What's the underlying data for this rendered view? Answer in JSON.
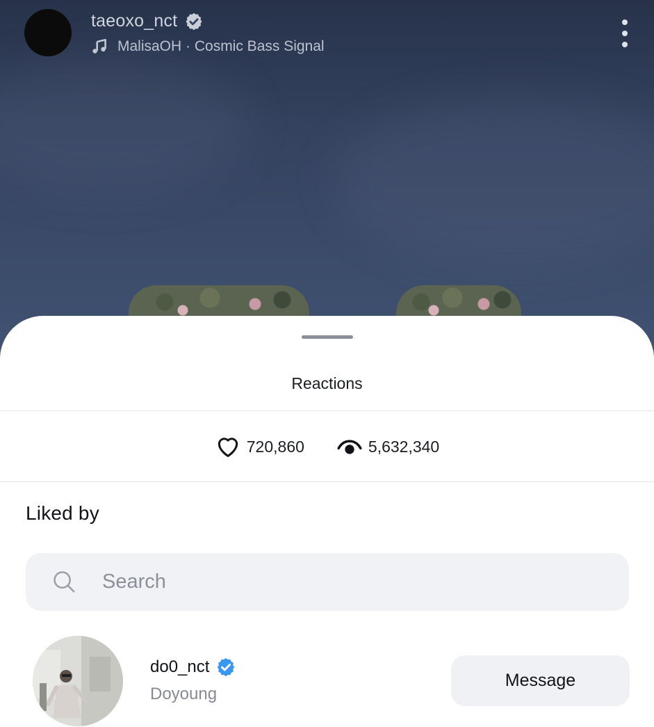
{
  "story": {
    "username": "taeoxo_nct",
    "verified_icon": "verified-badge-icon",
    "music_icon": "music-note-icon",
    "music_text": "MalisaOH · Cosmic Bass Signal",
    "more_icon": "more-vertical-icon"
  },
  "sheet": {
    "title": "Reactions",
    "likes_icon": "heart-outline-icon",
    "likes_count": "720,860",
    "views_icon": "eye-icon",
    "views_count": "5,632,340",
    "liked_by_label": "Liked by",
    "search": {
      "placeholder": "Search",
      "value": ""
    },
    "users": [
      {
        "username": "do0_nct",
        "display_name": "Doyoung",
        "verified": true,
        "button_label": "Message"
      }
    ]
  },
  "colors": {
    "verified_blue": "#3897f0",
    "sheet_bg": "#ffffff",
    "story_bg": "#34425f"
  }
}
